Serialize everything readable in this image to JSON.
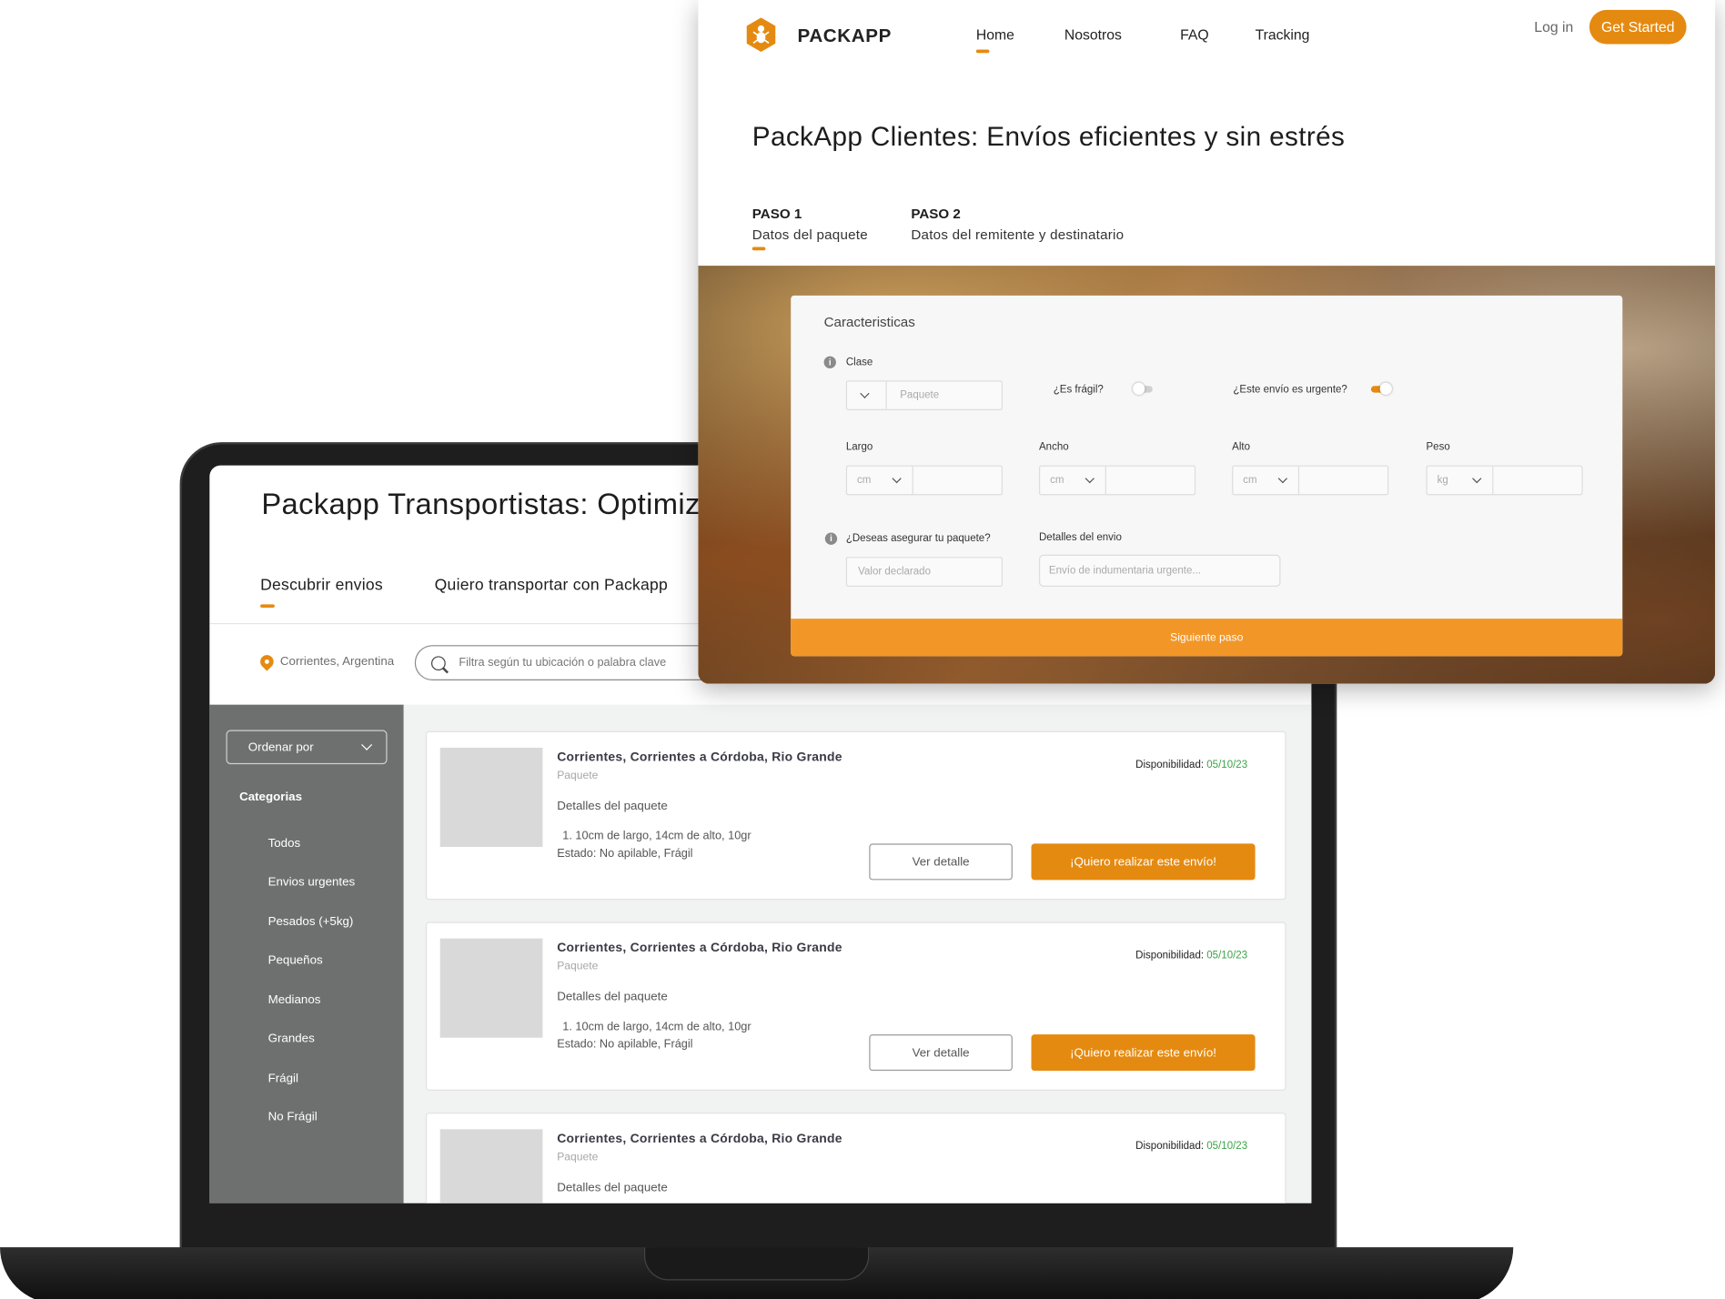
{
  "transportistas": {
    "title": "Packapp Transportistas: Optimiza tus rutas",
    "tabs": [
      "Descubrir envios",
      "Quiero transportar con Packapp"
    ],
    "location": "Corrientes, Argentina",
    "search_placeholder": "Filtra según tu ubicación o palabra clave",
    "sort_label": "Ordenar por",
    "categories_title": "Categorias",
    "categories": [
      "Todos",
      "Envios urgentes",
      "Pesados (+5kg)",
      "Pequeños",
      "Medianos",
      "Grandes",
      "Frágil",
      "No Frágil"
    ],
    "cards": [
      {
        "route": "Corrientes, Corrientes a Córdoba, Rio Grande",
        "type": "Paquete",
        "details_title": "Detalles del paquete",
        "line1": "1. 10cm de largo, 14cm de alto, 10gr",
        "line2": "Estado: No apilable, Frágil",
        "availability_label": "Disponibilidad:",
        "availability_date": "05/10/23",
        "view_label": "Ver detalle",
        "action_label": "¡Quiero realizar este envío!"
      },
      {
        "route": "Corrientes, Corrientes a Córdoba, Rio Grande",
        "type": "Paquete",
        "details_title": "Detalles del paquete",
        "line1": "1. 10cm de largo, 14cm de alto, 10gr",
        "line2": "Estado: No apilable, Frágil",
        "availability_label": "Disponibilidad:",
        "availability_date": "05/10/23",
        "view_label": "Ver detalle",
        "action_label": "¡Quiero realizar este envío!"
      },
      {
        "route": "Corrientes, Corrientes a Córdoba, Rio Grande",
        "type": "Paquete",
        "details_title": "Detalles del paquete",
        "availability_label": "Disponibilidad:",
        "availability_date": "05/10/23"
      }
    ]
  },
  "clientes": {
    "brand": "PACKAPP",
    "nav": [
      "Home",
      "Nosotros",
      "FAQ",
      "Tracking"
    ],
    "login": "Log in",
    "get_started": "Get Started",
    "title": "PackApp Clientes: Envíos eficientes y sin estrés",
    "steps": [
      {
        "head": "PASO 1",
        "sub": "Datos del paquete"
      },
      {
        "head": "PASO 2",
        "sub": "Datos del remitente y destinatario"
      }
    ],
    "form": {
      "title": "Caracteristicas",
      "clase_label": "Clase",
      "clase_placeholder": "Paquete",
      "fragil_label": "¿Es frágil?",
      "fragil_on": false,
      "urgente_label": "¿Este envío es urgente?",
      "urgente_on": true,
      "dims": [
        {
          "label": "Largo",
          "unit": "cm"
        },
        {
          "label": "Ancho",
          "unit": "cm"
        },
        {
          "label": "Alto",
          "unit": "cm"
        },
        {
          "label": "Peso",
          "unit": "kg"
        }
      ],
      "asegurar_label": "¿Deseas asegurar tu paquete?",
      "valor_placeholder": "Valor declarado",
      "detalles_label": "Detalles del envio",
      "detalles_placeholder": "Envío de indumentaria urgente...",
      "submit": "Siguiente paso"
    }
  },
  "colors": {
    "accent": "#e58a10",
    "availability_date": "#3aa447",
    "sidebar": "#6e7070"
  }
}
